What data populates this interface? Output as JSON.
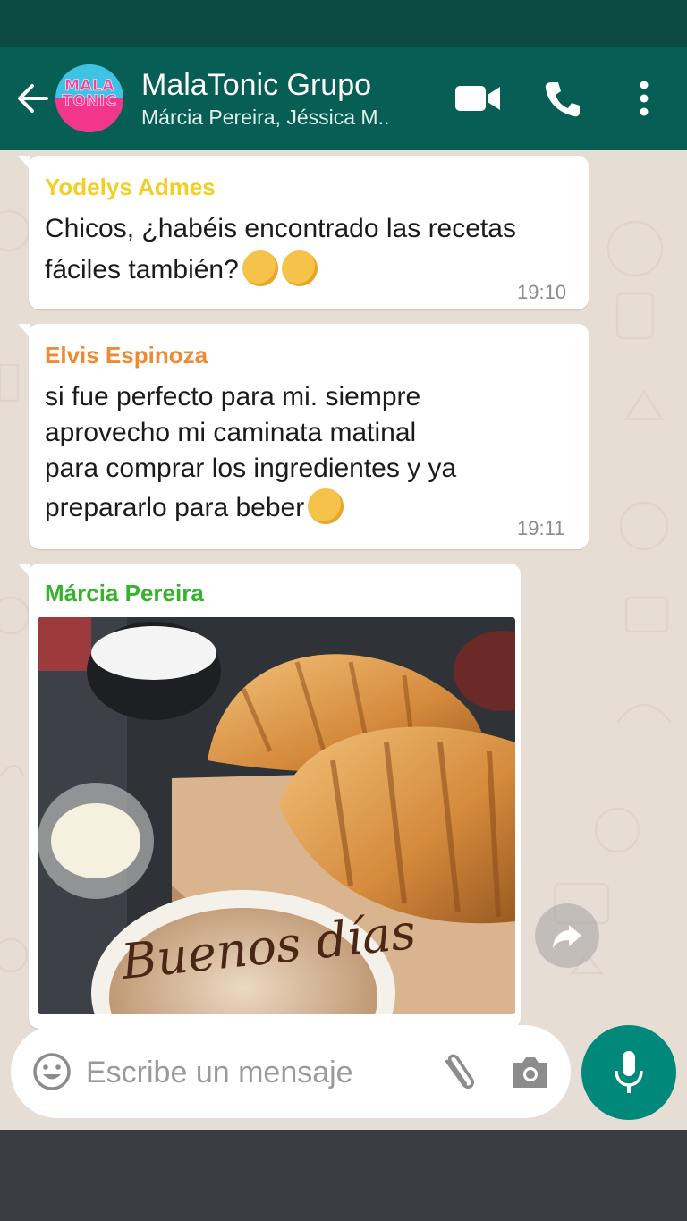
{
  "header": {
    "title": "MalaTonic Grupo",
    "subtitle": "Márcia Pereira, Jéssica M..",
    "avatar_text": "MALA TONIC",
    "icons": [
      "back-arrow-icon",
      "video-call-icon",
      "phone-call-icon",
      "more-options-icon"
    ]
  },
  "messages": [
    {
      "sender": "Yodelys Admes",
      "sender_color": "#f2cf26",
      "lines": [
        "Chicos, ¿habéis encontrado las recetas",
        "fáciles también?"
      ],
      "emoji": [
        "grinning-face",
        "grinning-face"
      ],
      "time": "19:10"
    },
    {
      "sender": "Elvis Espinoza",
      "sender_color": "#ef8a34",
      "lines": [
        "si fue perfecto para mi. siempre",
        "aprovecho mi caminata matinal",
        "para comprar los ingredientes y ya",
        "prepararlo para beber"
      ],
      "emoji": [
        "winking-face"
      ],
      "time": "19:11"
    },
    {
      "sender": "Márcia Pereira",
      "sender_color": "#35b32e",
      "image": "croissants-coffee-photo",
      "image_text": "Buenos días"
    }
  ],
  "composer": {
    "placeholder": "Escribe un mensaje",
    "icons": [
      "emoji-icon",
      "attach-icon",
      "camera-icon",
      "mic-icon"
    ]
  },
  "colors": {
    "header_bg": "#075e54",
    "statusbar_bg": "#0b4a41",
    "chat_bg": "#e6ddd4",
    "mic_bg": "#00897b"
  }
}
